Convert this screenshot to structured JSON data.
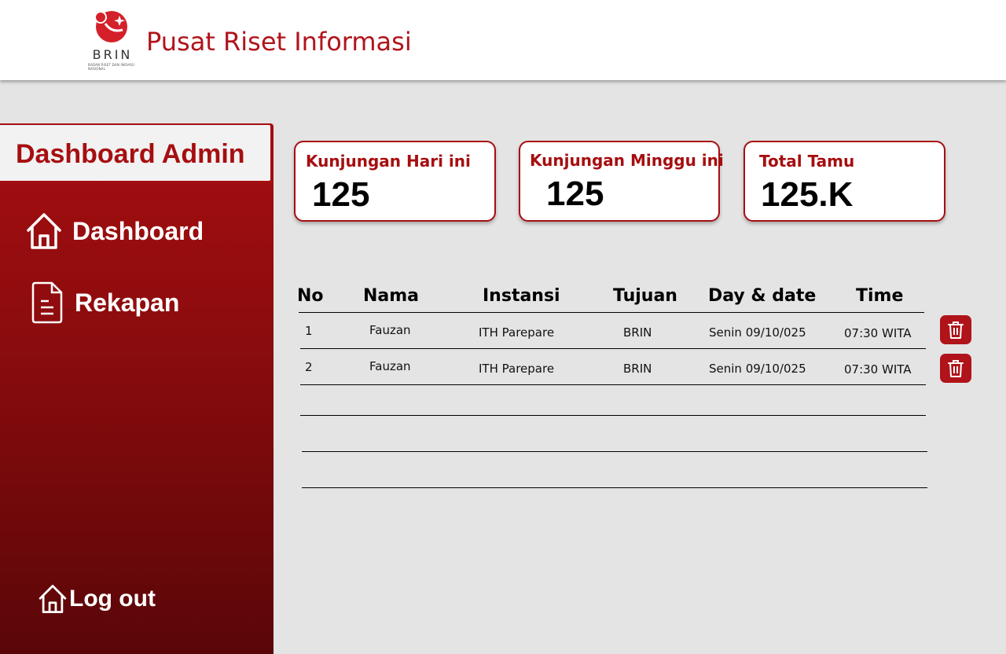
{
  "header": {
    "logo_text": "BRIN",
    "logo_subtext": "BADAN RISET DAN INOVASI NASIONAL",
    "title": "Pusat Riset Informasi"
  },
  "sidebar": {
    "title": "Dashboard Admin",
    "items": [
      {
        "label": "Dashboard",
        "icon": "home-icon"
      },
      {
        "label": "Rekapan",
        "icon": "document-icon"
      }
    ],
    "logout": {
      "label": "Log out",
      "icon": "home-icon"
    }
  },
  "stats": [
    {
      "label": "Kunjungan Hari ini",
      "value": "125"
    },
    {
      "label": "Kunjungan Minggu ini",
      "value": "125"
    },
    {
      "label": "Total Tamu",
      "value": "125.K"
    }
  ],
  "table": {
    "headers": [
      "No",
      "Nama",
      "Instansi",
      "Tujuan",
      "Day & date",
      "Time"
    ],
    "rows": [
      [
        "1",
        "Fauzan",
        "ITH Parepare",
        "BRIN",
        "Senin 09/10/025",
        "07:30 WITA"
      ],
      [
        "2",
        "Fauzan",
        "ITH Parepare",
        "BRIN",
        "Senin 09/10/025",
        "07:30 WITA"
      ]
    ],
    "row_action_icon": "trash-icon"
  },
  "colors": {
    "brand": "#a60e10",
    "background": "#e4e4e4"
  }
}
